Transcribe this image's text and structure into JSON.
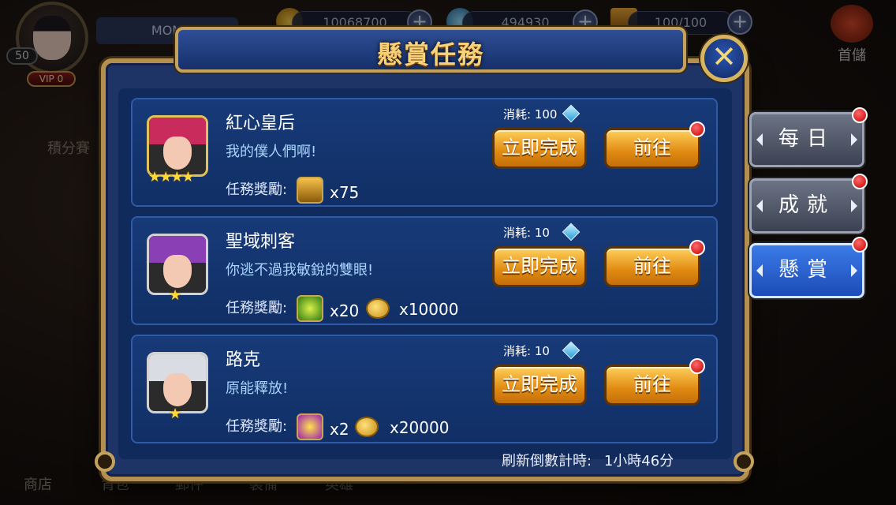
{
  "hud": {
    "player_name": "MOM",
    "level": "50",
    "vip": "VIP 0",
    "gold": "10068700",
    "diamonds": "494930",
    "stamina": "100/100",
    "first_top_up": "首儲"
  },
  "background": {
    "left_label": "積分賽",
    "bottom_nav": [
      "商店",
      "背包",
      "郵件",
      "裝備",
      "英雄"
    ]
  },
  "modal": {
    "title": "懸賞任務",
    "close_icon": "close-icon",
    "refresh_label": "刷新倒數計時:",
    "refresh_time": "1小時46分"
  },
  "quests": [
    {
      "name": "紅心皇后",
      "desc": "我的僕人們啊!",
      "stars": "★★★★",
      "cost_label": "消耗: 100",
      "complete_label": "立即完成",
      "go_label": "前往",
      "reward_label": "任務獎勵:",
      "rewards": [
        {
          "icon": "treasure-chest-icon",
          "amount": "x75"
        }
      ]
    },
    {
      "name": "聖域刺客",
      "desc": "你逃不過我敏銳的雙眼!",
      "stars": "★",
      "cost_label": "消耗: 10",
      "complete_label": "立即完成",
      "go_label": "前往",
      "reward_label": "任務獎勵:",
      "rewards": [
        {
          "icon": "green-fruit-icon",
          "amount": "x20"
        },
        {
          "icon": "gold-coin-icon",
          "amount": "x10000"
        }
      ]
    },
    {
      "name": "路克",
      "desc": "原能釋放!",
      "stars": "★",
      "cost_label": "消耗: 10",
      "complete_label": "立即完成",
      "go_label": "前往",
      "reward_label": "任務獎勵:",
      "rewards": [
        {
          "icon": "purple-fruit-icon",
          "amount": "x2"
        },
        {
          "icon": "gold-coin-icon",
          "amount": "x20000"
        }
      ]
    }
  ],
  "tabs": [
    {
      "label": "每日",
      "active": false
    },
    {
      "label": "成就",
      "active": false
    },
    {
      "label": "懸賞",
      "active": true
    }
  ],
  "colors": {
    "accent_gold": "#f7d27a",
    "button_gold": "#e08a12",
    "panel_blue": "#0f2a5b",
    "active_tab": "#3b7be8",
    "notification_red": "#c00000"
  }
}
